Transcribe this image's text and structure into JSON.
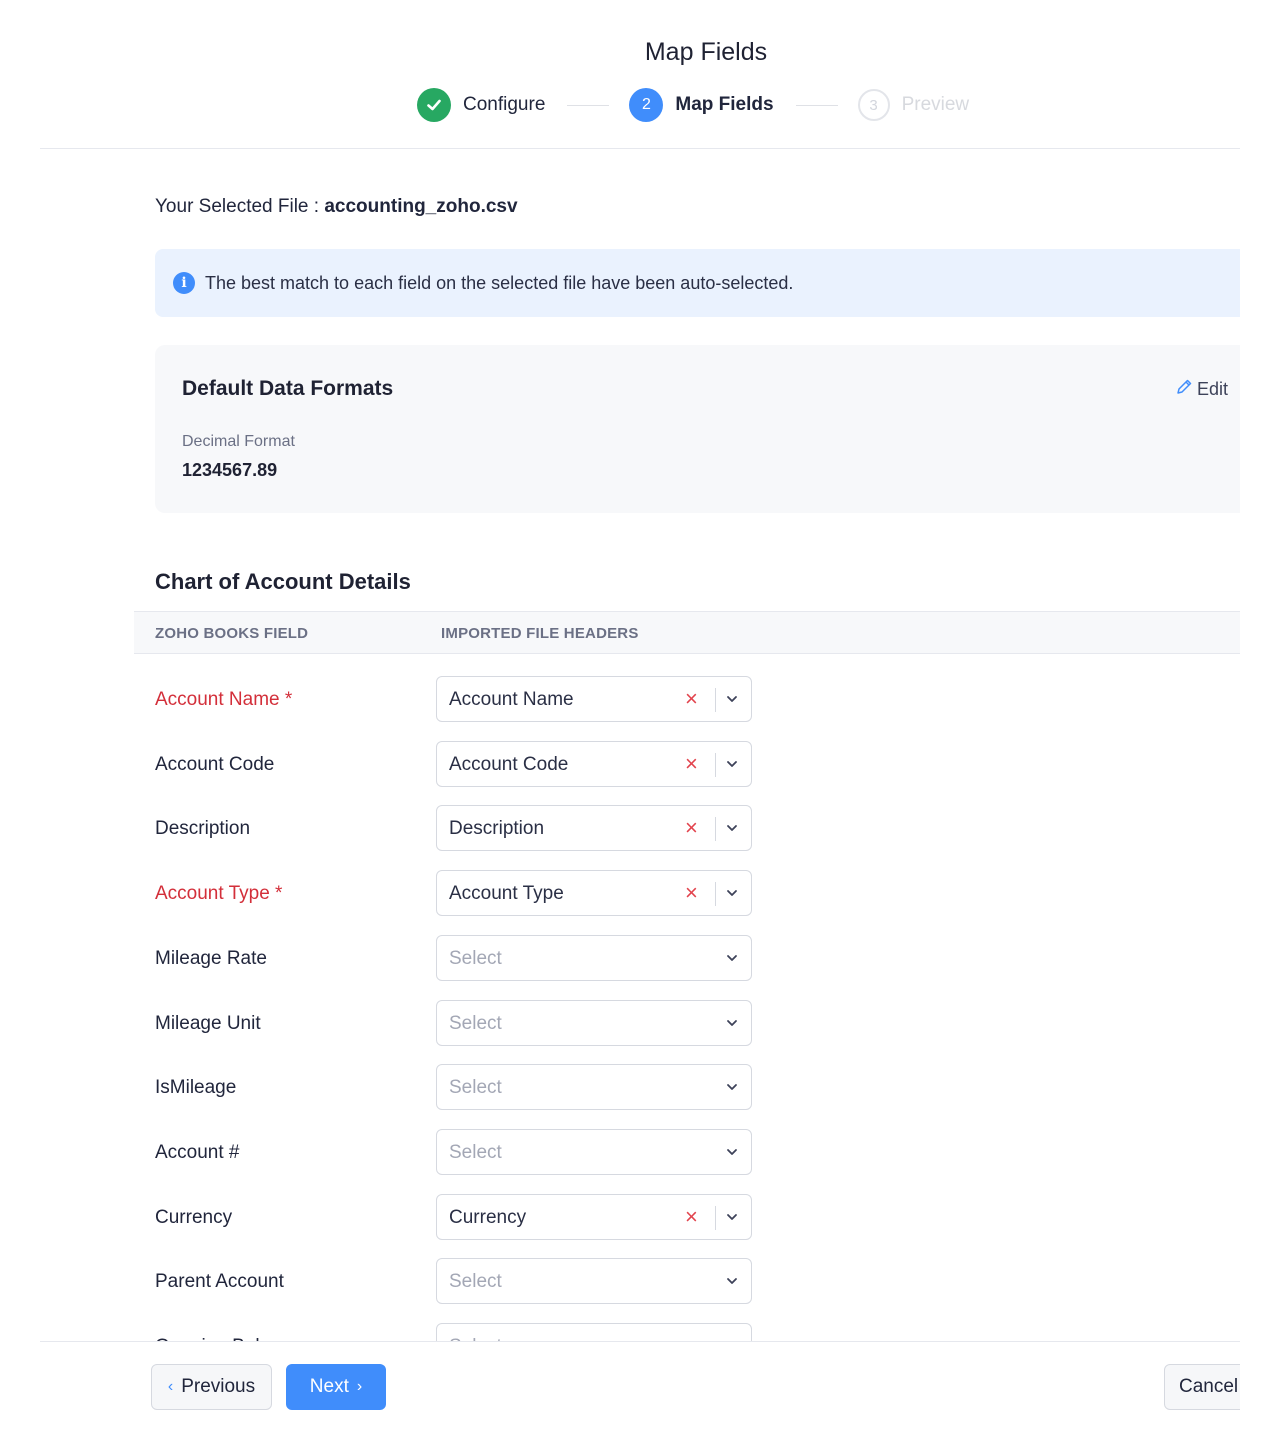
{
  "header": {
    "title": "Map Fields",
    "steps": [
      {
        "number": "",
        "label": "Configure",
        "state": "completed"
      },
      {
        "number": "2",
        "label": "Map Fields",
        "state": "active"
      },
      {
        "number": "3",
        "label": "Preview",
        "state": "pending"
      }
    ]
  },
  "selected_file": {
    "label": "Your Selected File : ",
    "name": "accounting_zoho.csv"
  },
  "info_banner": {
    "icon": "info-icon",
    "text": "The best match to each field on the selected file have been auto-selected."
  },
  "default_formats": {
    "title": "Default Data Formats",
    "edit_label": "Edit",
    "decimal_format_label": "Decimal Format",
    "decimal_format_value": "1234567.89"
  },
  "section": {
    "title": "Chart of Account Details",
    "col_field": "ZOHO BOOKS FIELD",
    "col_header": "IMPORTED FILE HEADERS"
  },
  "fields": [
    {
      "label": "Account Name *",
      "required": true,
      "value": "Account Name",
      "placeholder": false
    },
    {
      "label": "Account Code",
      "required": false,
      "value": "Account Code",
      "placeholder": false
    },
    {
      "label": "Description",
      "required": false,
      "value": "Description",
      "placeholder": false
    },
    {
      "label": "Account Type *",
      "required": true,
      "value": "Account Type",
      "placeholder": false
    },
    {
      "label": "Mileage Rate",
      "required": false,
      "value": "Select",
      "placeholder": true
    },
    {
      "label": "Mileage Unit",
      "required": false,
      "value": "Select",
      "placeholder": true
    },
    {
      "label": "IsMileage",
      "required": false,
      "value": "Select",
      "placeholder": true
    },
    {
      "label": "Account #",
      "required": false,
      "value": "Select",
      "placeholder": true
    },
    {
      "label": "Currency",
      "required": false,
      "value": "Currency",
      "placeholder": false
    },
    {
      "label": "Parent Account",
      "required": false,
      "value": "Select",
      "placeholder": true
    },
    {
      "label": "Opening Balance",
      "required": false,
      "value": "Select",
      "placeholder": true
    }
  ],
  "footer": {
    "previous_label": "Previous",
    "next_label": "Next",
    "cancel_label": "Cancel"
  },
  "colors": {
    "accent": "#408dfb",
    "success": "#27a862",
    "required": "#d32f3a",
    "clear": "#e2434d",
    "banner_bg": "#eaf2fe"
  }
}
